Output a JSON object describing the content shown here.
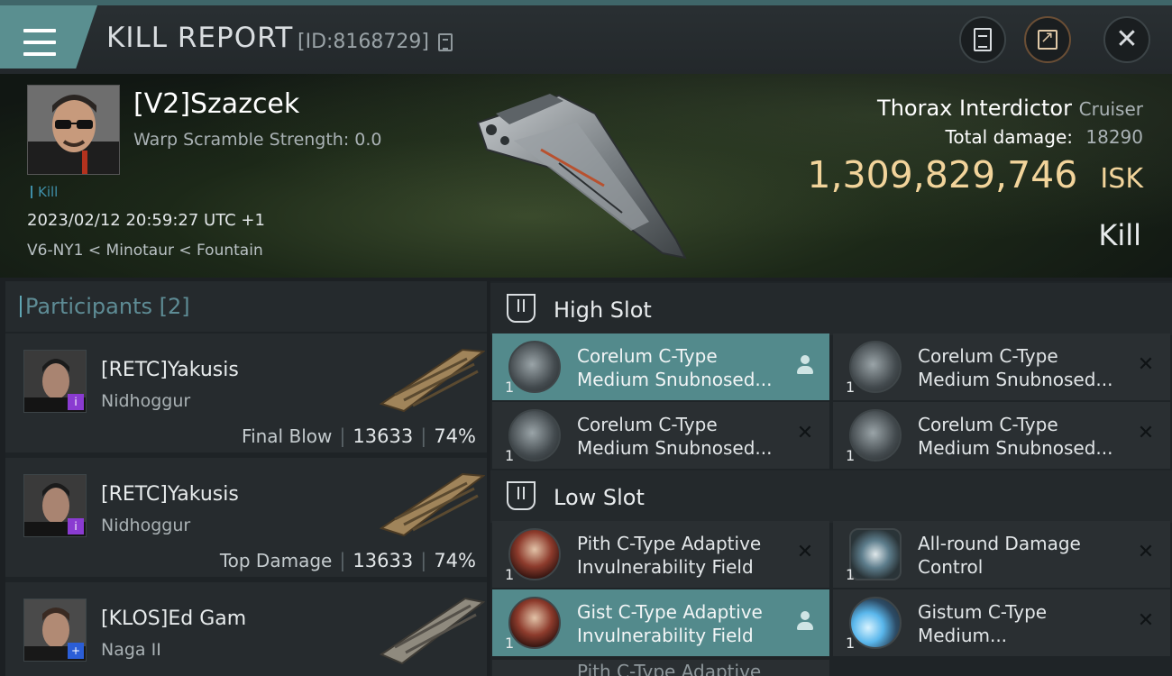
{
  "header": {
    "title": "KILL REPORT",
    "report_id": "[ID:8168729]",
    "icons": [
      "menu-icon",
      "copy-icon",
      "clipboard-icon",
      "share-icon",
      "close-icon"
    ]
  },
  "victim": {
    "name": "[V2]Szazcek",
    "warp_scramble": "Warp Scramble Strength: 0.0",
    "tag": "Kill",
    "datetime": "2023/02/12 20:59:27 UTC +1",
    "location": "V6-NY1 < Minotaur < Fountain",
    "ship": "Thorax Interdictor",
    "ship_class": "Cruiser",
    "total_damage_label": "Total damage:",
    "total_damage": "18290",
    "isk_value": "1,309,829,746",
    "isk_unit": "ISK",
    "result": "Kill"
  },
  "participants": {
    "title": "Participants",
    "count": "[2]",
    "rows": [
      {
        "name": "[RETC]Yakusis",
        "ship": "Nidhoggur",
        "label": "Final Blow",
        "damage": "13633",
        "percent": "74%",
        "badge": "i"
      },
      {
        "name": "[RETC]Yakusis",
        "ship": "Nidhoggur",
        "label": "Top Damage",
        "damage": "13633",
        "percent": "74%",
        "badge": "i"
      },
      {
        "name": "[KLOS]Ed Gam",
        "ship": "Naga II",
        "badge": "+"
      }
    ]
  },
  "slots": {
    "high": {
      "title": "High Slot",
      "items": [
        {
          "name": "Corelum C-Type Medium Snubnosed...",
          "qty": "1",
          "selected": true
        },
        {
          "name": "Corelum C-Type Medium Snubnosed...",
          "qty": "1",
          "selected": false
        },
        {
          "name": "Corelum C-Type Medium Snubnosed...",
          "qty": "1",
          "selected": false
        },
        {
          "name": "Corelum C-Type Medium Snubnosed...",
          "qty": "1",
          "selected": false
        }
      ]
    },
    "low": {
      "title": "Low Slot",
      "items": [
        {
          "name": "Pith C-Type Adaptive Invulnerability Field",
          "qty": "1",
          "selected": false
        },
        {
          "name": "All-round Damage Control",
          "qty": "1",
          "selected": false
        },
        {
          "name": "Gist C-Type Adaptive Invulnerability Field",
          "qty": "1",
          "selected": true
        },
        {
          "name": "Gistum C-Type Medium...",
          "qty": "1",
          "selected": false
        }
      ],
      "peek": "Pith C-Type Adaptive"
    }
  },
  "colors": {
    "accent": "#538a8c",
    "isk_gold": "#f2d49b",
    "badge_purple": "#8a3bd1",
    "badge_blue": "#2b5ed7"
  }
}
